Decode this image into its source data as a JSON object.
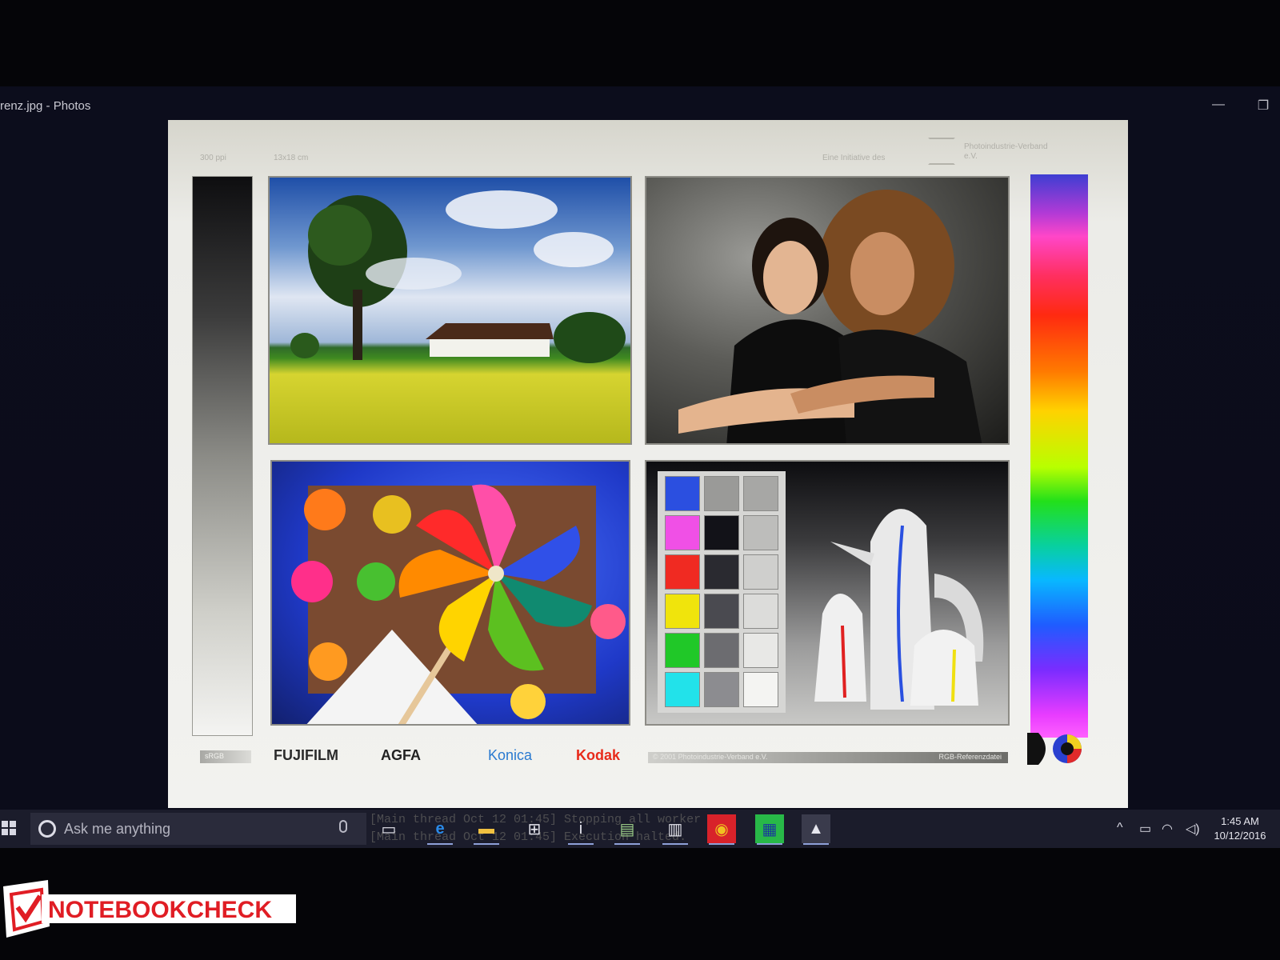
{
  "window": {
    "title": "renz.jpg - Photos",
    "minimize_glyph": "—",
    "restore_glyph": "❐"
  },
  "image": {
    "resolution_label": "300 ppi",
    "size_label": "13x18 cm",
    "initiative_label": "Eine Initiative des",
    "verband_name": "Photoindustrie-Verband e.V.",
    "srgb_label": "sRGB",
    "brands": [
      "FUJIFILM",
      "AGFA",
      "Konica",
      "Kodak"
    ],
    "copyright": "© 2001 Photoindustrie-Verband e.V.",
    "file_label": "RGB-Referenzdatei",
    "swatch_colors": [
      "#2b4fe0",
      "#9a9a98",
      "#a7a7a5",
      "#f050e6",
      "#121218",
      "#bdbdbb",
      "#f02a22",
      "#2a2a30",
      "#cfcfcd",
      "#f0e40c",
      "#4a4a50",
      "#dcdcda",
      "#20c828",
      "#6c6c70",
      "#e8e8e6",
      "#22e2ea",
      "#8c8c90",
      "#f4f4f2"
    ]
  },
  "taskbar": {
    "search_placeholder": "Ask me anything",
    "console_line1": "[Main thread Oct 12 01:45] Stopping all worker threads",
    "console_line2": "[Main thread Oct 12 01:45] Execution halted.",
    "task_view_icon": "task-view-icon",
    "apps": [
      "edge-icon",
      "file-explorer-icon",
      "store-icon",
      "tool-icon",
      "notepad-icon",
      "monitor-tool-icon",
      "benchmark-icon",
      "gpu-tool-icon",
      "photos-icon"
    ],
    "time": "1:45 AM",
    "date": "10/12/2016"
  },
  "watermark": {
    "text": "NOTEBOOKCHECK"
  },
  "colors": {
    "taskbar_bg": "#1b1c2b",
    "accent": "#8ea0d8",
    "watermark_red": "#e01d24"
  }
}
